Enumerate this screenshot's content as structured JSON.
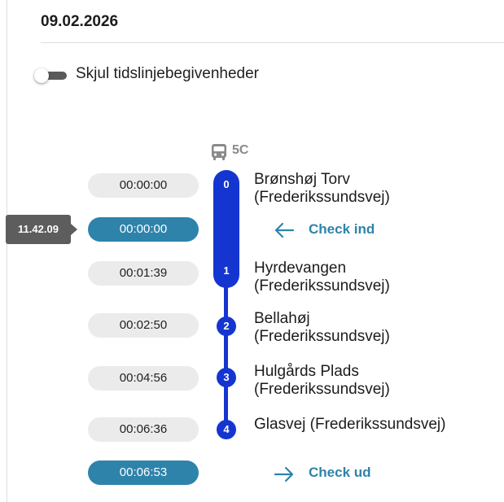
{
  "header": {
    "date": "09.02.2026"
  },
  "toggle": {
    "label": "Skjul tidslinjebegivenheder"
  },
  "route": {
    "icon": "bus-icon",
    "label": "5C"
  },
  "clock_badge": "11.42.09",
  "times": [
    "00:00:00",
    "00:00:00",
    "00:01:39",
    "00:02:50",
    "00:04:56",
    "00:06:36",
    "00:06:53"
  ],
  "stops": [
    {
      "number": "0",
      "line1": "Brønshøj Torv",
      "line2": "(Frederikssundsvej)"
    },
    {
      "number": "1",
      "line1": "Hyrdevangen",
      "line2": "(Frederikssundsvej)"
    },
    {
      "number": "2",
      "line1": "Bellahøj",
      "line2": "(Frederikssundsvej)"
    },
    {
      "number": "3",
      "line1": "Hulgårds Plads",
      "line2": "(Frederikssundsvej)"
    },
    {
      "number": "4",
      "line1": "Glasvej (Frederikssundsvej)",
      "line2": ""
    }
  ],
  "events": {
    "check_in": {
      "label": "Check ind",
      "icon": "arrow-left-icon"
    },
    "check_out": {
      "label": "Check ud",
      "icon": "arrow-right-icon"
    }
  },
  "colors": {
    "route_blue": "#1535d1",
    "accent_teal": "#2e83aa",
    "badge_gray": "#5d5d5d"
  }
}
